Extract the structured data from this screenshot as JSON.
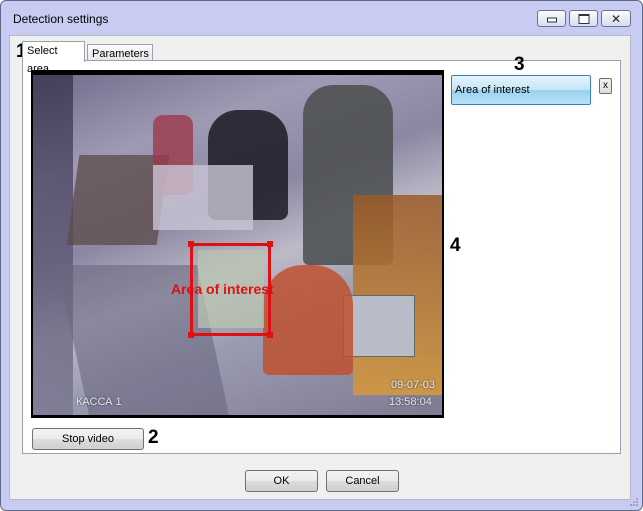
{
  "window": {
    "title": "Detection settings"
  },
  "tabs": [
    {
      "label": "Select area"
    },
    {
      "label": "Parameters"
    }
  ],
  "annotations": [
    "1",
    "2",
    "3",
    "4"
  ],
  "video": {
    "overlay_label": "Area of interest",
    "camera_label": "КАССА 1",
    "date": "09-07-03",
    "time": "13:58:04"
  },
  "area_list": {
    "selected_item": "Area of interest",
    "remove_label": "x"
  },
  "buttons": {
    "stop_video": "Stop video",
    "ok": "OK",
    "cancel": "Cancel"
  },
  "colors": {
    "area_outline": "#e01010",
    "selected_item": "#98d1ef",
    "window_frame": "#c8ccf2"
  }
}
